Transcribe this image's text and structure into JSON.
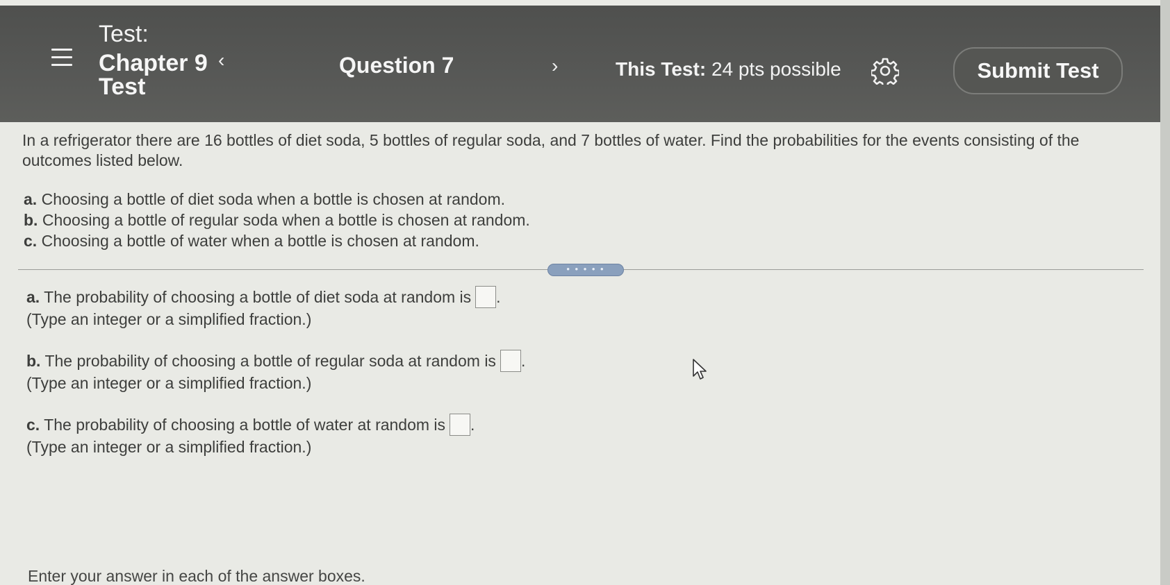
{
  "header": {
    "test_label": "Test:",
    "test_name": "Chapter 9 Test",
    "prev_symbol": "‹",
    "question_title": "Question 7",
    "next_symbol": "›",
    "points_label": "This Test:",
    "points_value": "24 pts possible",
    "submit_label": "Submit Test",
    "menu_icon": "hamburger-menu-icon",
    "settings_icon": "gear-icon"
  },
  "problem": {
    "text": "In a refrigerator there are 16 bottles of diet soda, 5 bottles of regular soda, and 7 bottles of water. Find the probabilities for the events consisting of the outcomes listed below.",
    "parts": [
      {
        "letter": "a.",
        "text": "Choosing a bottle of diet soda when a bottle is chosen at random."
      },
      {
        "letter": "b.",
        "text": "Choosing a bottle of regular soda when a bottle is chosen at random."
      },
      {
        "letter": "c.",
        "text": "Choosing a bottle of water when a bottle is chosen at random."
      }
    ]
  },
  "splitter_label": "• • • • •",
  "answers": [
    {
      "letter": "a.",
      "text": "The probability of choosing a bottle of diet soda at random is",
      "value": "",
      "hint": "(Type an integer or a simplified fraction.)"
    },
    {
      "letter": "b.",
      "text": "The probability of choosing a bottle of regular soda at random is",
      "value": "",
      "hint": "(Type an integer or a simplified fraction.)"
    },
    {
      "letter": "c.",
      "text": "The probability of choosing a bottle of water at random is",
      "value": "",
      "hint": "(Type an integer or a simplified fraction.)"
    }
  ],
  "footer": {
    "instruction": "Enter your answer in each of the answer boxes."
  },
  "colors": {
    "header_bg": "#555653",
    "page_bg": "#e9eae5",
    "text": "#3d3e3c",
    "splitter": "#8aa0bd"
  }
}
